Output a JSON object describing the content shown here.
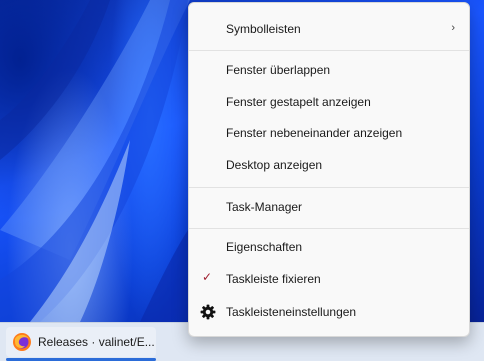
{
  "menu": {
    "items": [
      {
        "label": "Symbolleisten",
        "submenu": true
      },
      {
        "label": "Fenster überlappen"
      },
      {
        "label": "Fenster gestapelt anzeigen"
      },
      {
        "label": "Fenster nebeneinander anzeigen"
      },
      {
        "label": "Desktop anzeigen"
      },
      {
        "label": "Task-Manager"
      },
      {
        "label": "Eigenschaften"
      },
      {
        "label": "Taskleiste fixieren",
        "checked": true
      },
      {
        "label": "Taskleisteneinstellungen",
        "icon": "gear-icon"
      }
    ],
    "submenu_glyph": "›",
    "check_glyph": "✓"
  },
  "taskbar": {
    "window_button": {
      "label": "Releases · valinet/E...",
      "icon": "firefox-icon"
    }
  },
  "colors": {
    "check": "#a02030",
    "taskbar": "#dfe7f3",
    "menu_bg": "#f9f9f9"
  }
}
